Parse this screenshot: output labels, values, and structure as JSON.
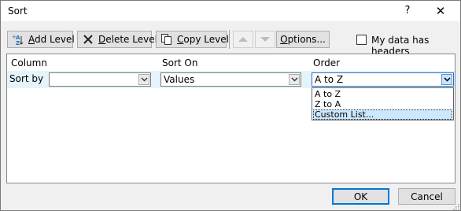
{
  "window": {
    "title": "Sort",
    "help_glyph": "?",
    "close_glyph": "✕"
  },
  "toolbar": {
    "add_level": {
      "mnemonic": "A",
      "rest": "dd Level",
      "icon": "add-level-icon"
    },
    "delete_level": {
      "mnemonic": "D",
      "rest": "elete Level",
      "icon": "delete-x-icon"
    },
    "copy_level": {
      "mnemonic": "C",
      "rest": "opy Level",
      "icon": "copy-icon"
    },
    "move_up_icon": "arrow-up-icon",
    "move_down_icon": "arrow-down-icon",
    "options": {
      "mnemonic": "O",
      "rest": "ptions..."
    }
  },
  "headers_checkbox": {
    "pre": "My data has ",
    "mnemonic": "h",
    "post": "eaders",
    "checked": false
  },
  "grid": {
    "headers": {
      "column": "Column",
      "sort_on": "Sort On",
      "order": "Order"
    },
    "rows": [
      {
        "label": "Sort by",
        "column": "",
        "sort_on": "Values",
        "order": "A to Z"
      }
    ]
  },
  "order_dropdown": {
    "options": [
      "A to Z",
      "Z to A",
      "Custom List..."
    ],
    "highlighted": "Custom List..."
  },
  "footer": {
    "ok": "OK",
    "cancel": "Cancel"
  },
  "colors": {
    "accent": "#0078d7",
    "row_highlight": "#e5f3fb",
    "option_highlight": "#cce8ff"
  }
}
